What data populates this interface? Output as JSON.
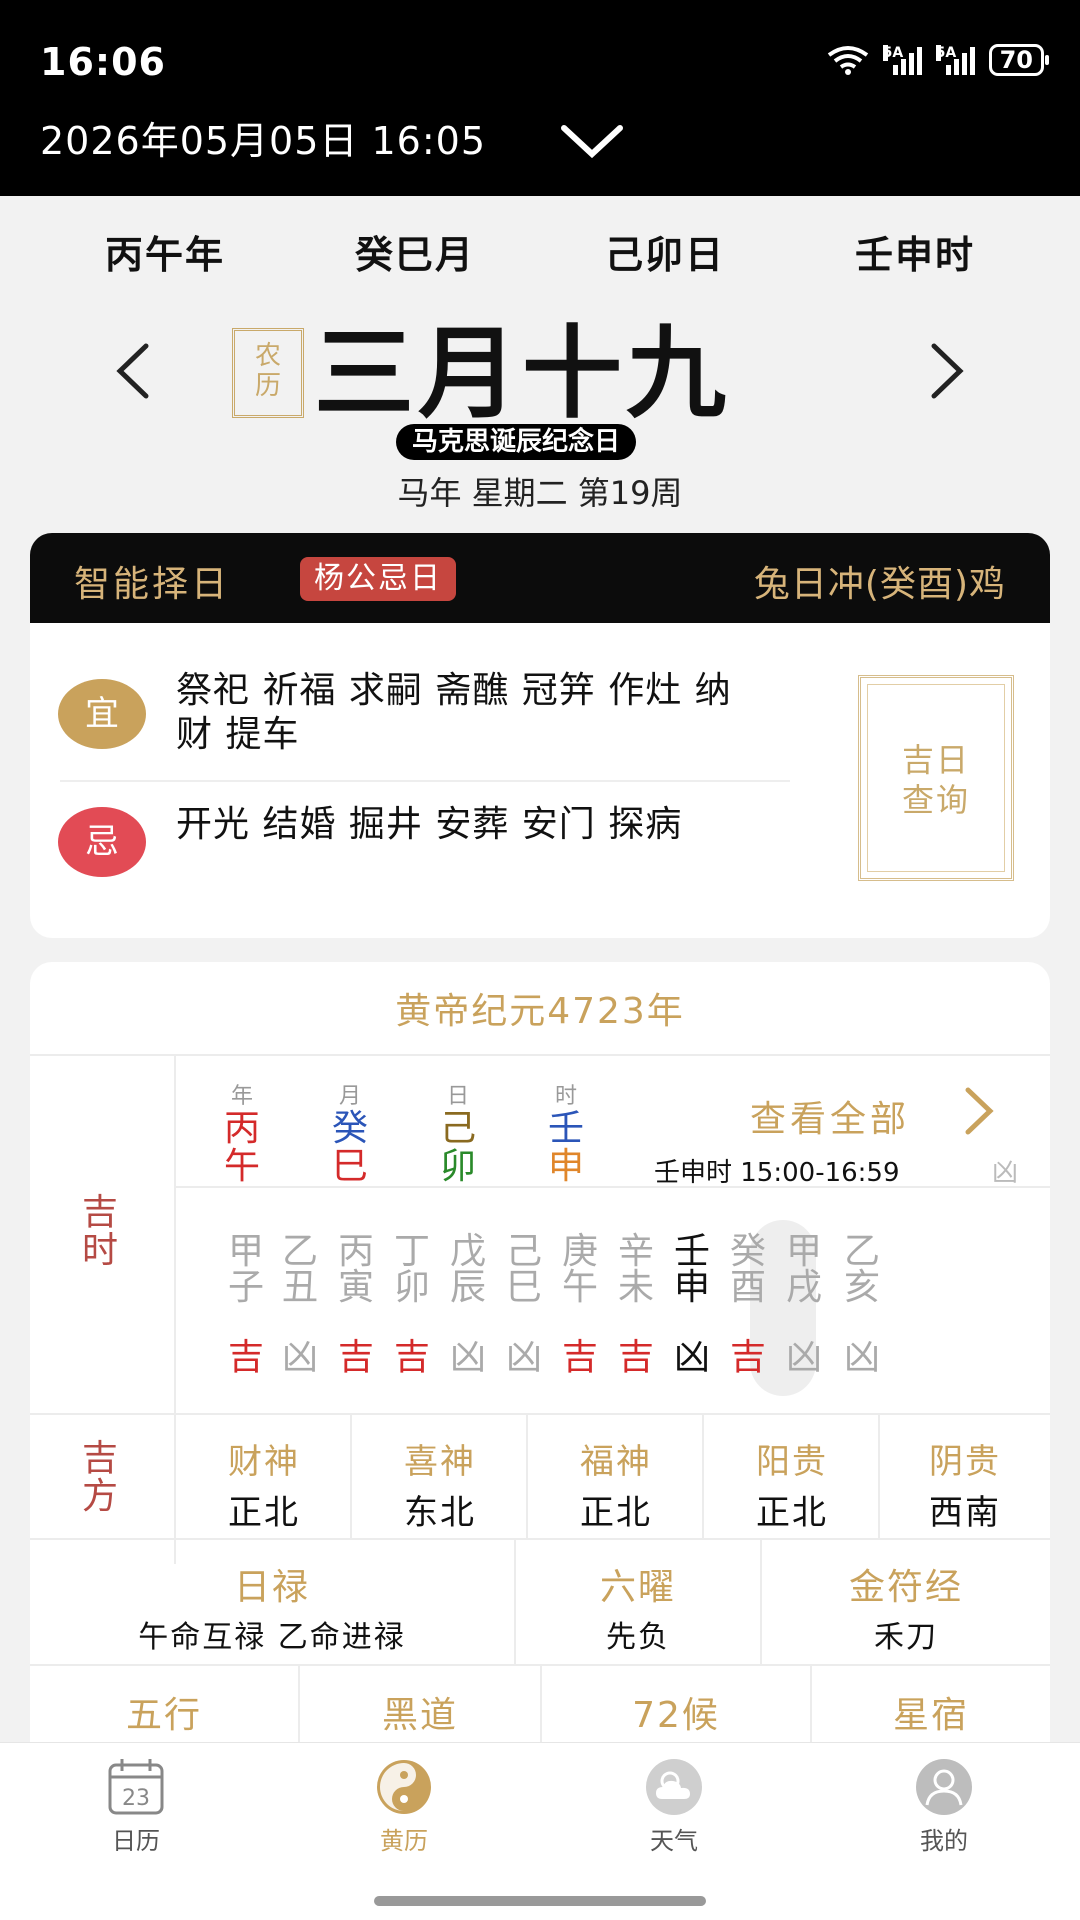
{
  "status_bar": {
    "time": "16:06",
    "net1": "5A",
    "net2": "5A",
    "battery": "70"
  },
  "header": {
    "datetime": "2026年05月05日 16:05"
  },
  "ganzhi": [
    "丙午年",
    "癸巳月",
    "己卯日",
    "壬申时"
  ],
  "lunar": {
    "badge_1": "农",
    "badge_2": "历",
    "date": "三月十九",
    "festival": "马克思诞辰纪念日",
    "week_info": "马年 星期二 第19周"
  },
  "zeri": {
    "title": "智能择日",
    "tag": "杨公忌日",
    "chong": "兔日冲(癸酉)鸡",
    "yi_label": "宜",
    "yi_text": "祭祀 祈福 求嗣 斋醮 冠笄 作灶 纳财 提车",
    "ji_label": "忌",
    "ji_text": "开光 结婚 掘井 安葬 安门 探病",
    "jiri_line1": "吉日",
    "jiri_line2": "查询"
  },
  "almanac": {
    "era": "黄帝纪元4723年",
    "jishi_label": [
      "吉",
      "时"
    ],
    "pillars": [
      {
        "head": "年",
        "gan": "丙",
        "zhi": "午",
        "color": "#d42a2a"
      },
      {
        "head": "月",
        "gan": "癸",
        "zhi": "巳",
        "color_gan": "#2b55b8",
        "color": "#d42a2a"
      },
      {
        "head": "日",
        "gan": "己",
        "zhi": "卯",
        "color_gan": "#8a6a20",
        "color": "#2a8a2a"
      },
      {
        "head": "时",
        "gan": "壬",
        "zhi": "申",
        "color_gan": "#2b55b8",
        "color": "#e0862a"
      }
    ],
    "view_all": "查看全部",
    "shichen_time": "壬申时 15:00-16:59",
    "shichen_luck": "凶",
    "hours": [
      {
        "gan": "甲",
        "zhi": "子",
        "luck": "吉"
      },
      {
        "gan": "乙",
        "zhi": "丑",
        "luck": "凶"
      },
      {
        "gan": "丙",
        "zhi": "寅",
        "luck": "吉"
      },
      {
        "gan": "丁",
        "zhi": "卯",
        "luck": "吉"
      },
      {
        "gan": "戊",
        "zhi": "辰",
        "luck": "凶"
      },
      {
        "gan": "己",
        "zhi": "巳",
        "luck": "凶"
      },
      {
        "gan": "庚",
        "zhi": "午",
        "luck": "吉"
      },
      {
        "gan": "辛",
        "zhi": "未",
        "luck": "吉"
      },
      {
        "gan": "壬",
        "zhi": "申",
        "luck": "凶",
        "current": true
      },
      {
        "gan": "癸",
        "zhi": "酉",
        "luck": "吉"
      },
      {
        "gan": "甲",
        "zhi": "戌",
        "luck": "凶"
      },
      {
        "gan": "乙",
        "zhi": "亥",
        "luck": "凶"
      }
    ],
    "jifang_label": [
      "吉",
      "方"
    ],
    "directions": [
      {
        "label": "财神",
        "value": "正北"
      },
      {
        "label": "喜神",
        "value": "东北"
      },
      {
        "label": "福神",
        "value": "正北"
      },
      {
        "label": "阳贵",
        "value": "正北"
      },
      {
        "label": "阴贵",
        "value": "西南"
      }
    ],
    "rilu": {
      "label": "日禄",
      "value": "午命互禄 乙命进禄"
    },
    "liuyao": {
      "label": "六曜",
      "value": "先负"
    },
    "jinfu": {
      "label": "金符经",
      "value": "禾刀"
    },
    "bottom_row": [
      "五行",
      "黑道",
      "72候",
      "星宿"
    ]
  },
  "tabs": [
    {
      "label": "日历",
      "icon": "calendar-icon",
      "num": "23"
    },
    {
      "label": "黄历",
      "icon": "yinyang-icon",
      "active": true
    },
    {
      "label": "天气",
      "icon": "weather-icon"
    },
    {
      "label": "我的",
      "icon": "profile-icon"
    }
  ],
  "colors": {
    "gold": "#c9a25c",
    "ji_red": "#e24b55",
    "luck_red": "#d42a2a",
    "brown_red": "#b54a44"
  }
}
